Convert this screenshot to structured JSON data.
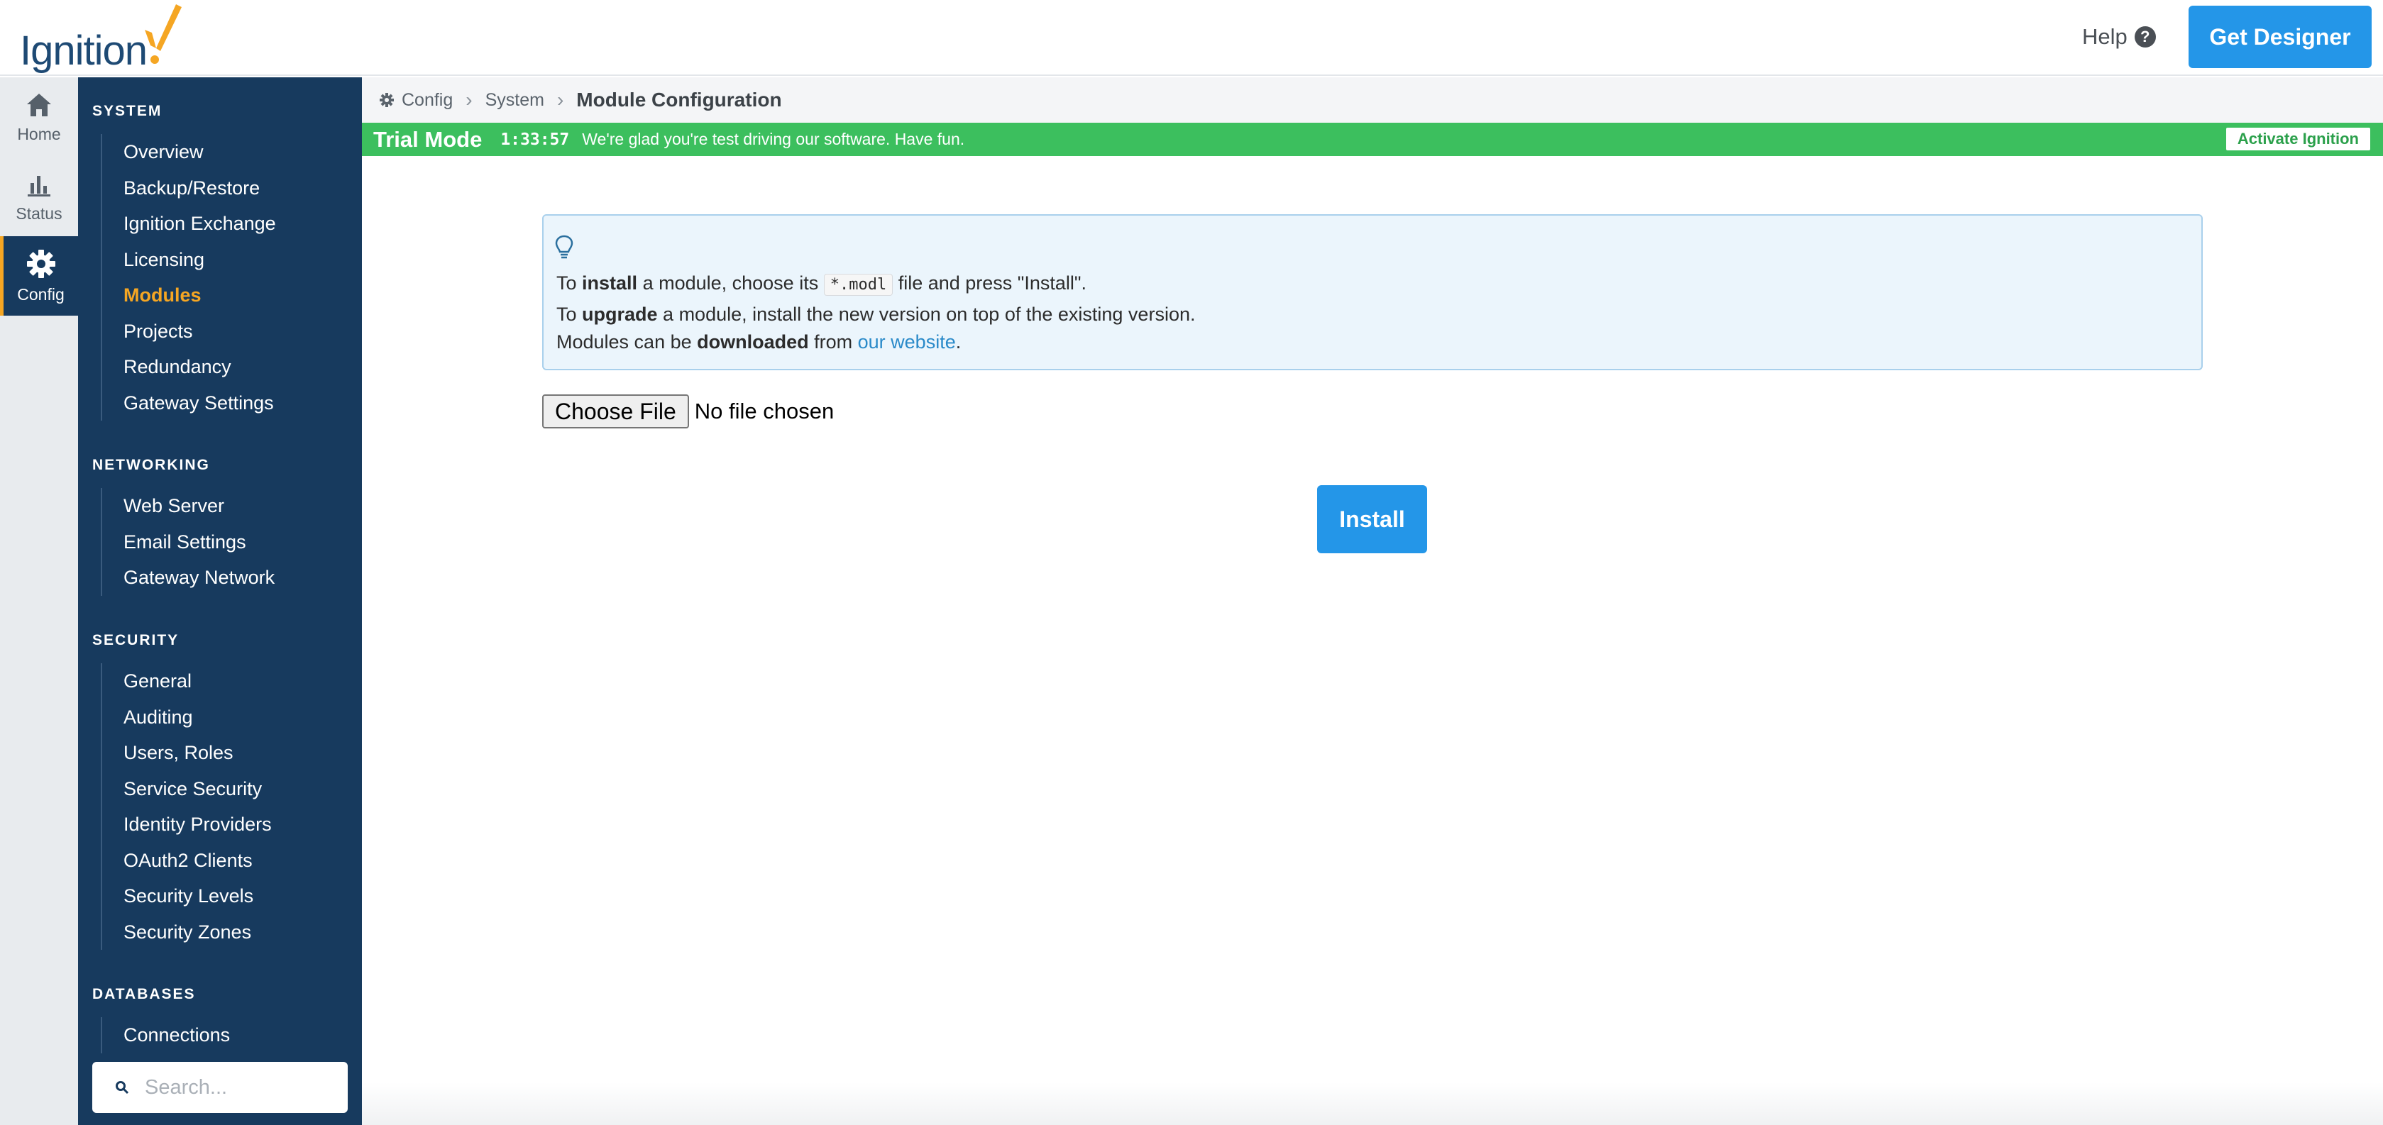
{
  "app": {
    "logo_text": "Ignition",
    "help_label": "Help",
    "get_designer_label": "Get Designer"
  },
  "rail": {
    "items": [
      {
        "label": "Home",
        "icon": "home-icon"
      },
      {
        "label": "Status",
        "icon": "bar-chart-icon"
      },
      {
        "label": "Config",
        "icon": "gear-icon",
        "active": true
      }
    ]
  },
  "sidebar": {
    "sections": [
      {
        "title": "SYSTEM",
        "items": [
          "Overview",
          "Backup/Restore",
          "Ignition Exchange",
          "Licensing",
          "Modules",
          "Projects",
          "Redundancy",
          "Gateway Settings"
        ],
        "active": "Modules"
      },
      {
        "title": "NETWORKING",
        "items": [
          "Web Server",
          "Email Settings",
          "Gateway Network"
        ]
      },
      {
        "title": "SECURITY",
        "items": [
          "General",
          "Auditing",
          "Users, Roles",
          "Service Security",
          "Identity Providers",
          "OAuth2 Clients",
          "Security Levels",
          "Security Zones"
        ]
      },
      {
        "title": "DATABASES",
        "items": [
          "Connections"
        ]
      }
    ],
    "search_placeholder": "Search..."
  },
  "breadcrumb": {
    "items": [
      "Config",
      "System"
    ],
    "current": "Module Configuration"
  },
  "trial": {
    "title": "Trial Mode",
    "time": "1:33:57",
    "message": "We're glad you're test driving our software. Have fun.",
    "activate_label": "Activate Ignition"
  },
  "info": {
    "line1": {
      "pre": "To ",
      "bold": "install",
      "mid": " a module, choose its ",
      "code": "*.modl",
      "post": " file and press \"Install\"."
    },
    "line2": {
      "pre": "To ",
      "bold": "upgrade",
      "post": " a module, install the new version on top of the existing version."
    },
    "line3": {
      "pre": "Modules can be ",
      "bold": "downloaded",
      "mid": " from ",
      "link": "our website",
      "post": "."
    }
  },
  "file_input": {
    "button_label": "Choose File",
    "status": "No file chosen"
  },
  "install_label": "Install",
  "colors": {
    "sidebar_bg": "#173a5e",
    "accent_orange": "#f5a623",
    "primary_blue": "#2496e8",
    "trial_green": "#3cbf5e"
  }
}
